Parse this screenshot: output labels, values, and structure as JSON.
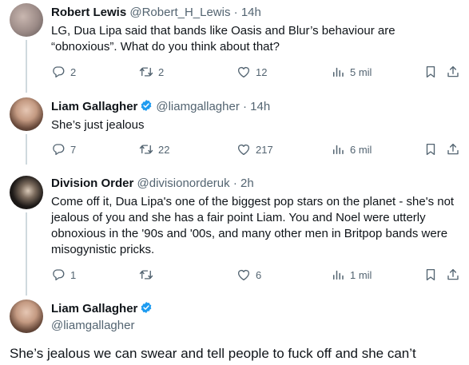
{
  "tweets": [
    {
      "name": "Robert Lewis",
      "handle": "@Robert_H_Lewis",
      "time": "· 14h",
      "text": "LG, Dua Lipa said that bands like Oasis and Blur’s behaviour are “obnoxious”. What do you think about that?",
      "replies": "2",
      "retweets": "2",
      "likes": "12",
      "views": "5 mil"
    },
    {
      "name": "Liam Gallagher",
      "handle": "@liamgallagher",
      "time": "· 14h",
      "text": "She’s just jealous",
      "replies": "7",
      "retweets": "22",
      "likes": "217",
      "views": "6 mil"
    },
    {
      "name": "Division Order",
      "handle": "@divisionorderuk",
      "time": "· 2h",
      "text": "Come off it, Dua Lipa's one of the biggest pop stars on the planet - she's not jealous of you and she has a fair point Liam. You and Noel were utterly obnoxious in the '90s and '00s, and many other men in Britpop bands were misogynistic pricks.",
      "replies": "1",
      "retweets": "",
      "likes": "6",
      "views": "1 mil"
    }
  ],
  "main_tweet": {
    "name": "Liam Gallagher",
    "handle": "@liamgallagher",
    "text": "She’s jealous we can swear and tell people to fuck off and she can’t"
  },
  "colors": {
    "text": "#0f1419",
    "secondary": "#536471",
    "verified": "#1d9bf0",
    "thread_line": "#cfd9de"
  },
  "icons": [
    "reply-icon",
    "retweet-icon",
    "like-icon",
    "views-icon",
    "bookmark-icon",
    "share-icon",
    "verified-badge-icon"
  ]
}
